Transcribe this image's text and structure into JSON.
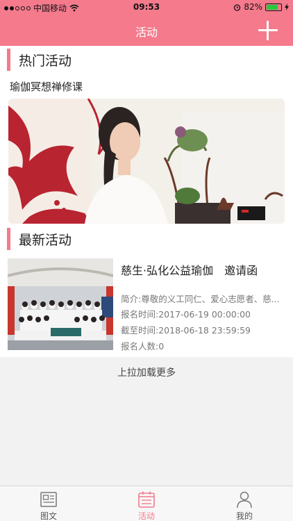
{
  "status_bar": {
    "carrier": "中国移动",
    "time": "09:53",
    "battery": "82%",
    "battery_level": 0.82
  },
  "nav": {
    "title": "活动"
  },
  "hot": {
    "section_title": "热门活动",
    "item_title": "瑜伽冥想禅修课"
  },
  "latest": {
    "section_title": "最新活动",
    "item": {
      "title": "慈生·弘化公益瑜伽　邀请函",
      "intro": "简介:尊敬的义工同仁、爱心志愿者、慈...",
      "signup_time": "报名时间:2017-06-19 00:00:00",
      "deadline": "截至时间:2018-06-18 23:59:59",
      "signup_count": "报名人数:0"
    }
  },
  "load_more": "上拉加载更多",
  "tabs": [
    {
      "label": "图文",
      "icon": "news-icon",
      "active": false
    },
    {
      "label": "活动",
      "icon": "calendar-icon",
      "active": true
    },
    {
      "label": "我的",
      "icon": "user-icon",
      "active": false
    }
  ],
  "colors": {
    "accent": "#f47a8c"
  }
}
